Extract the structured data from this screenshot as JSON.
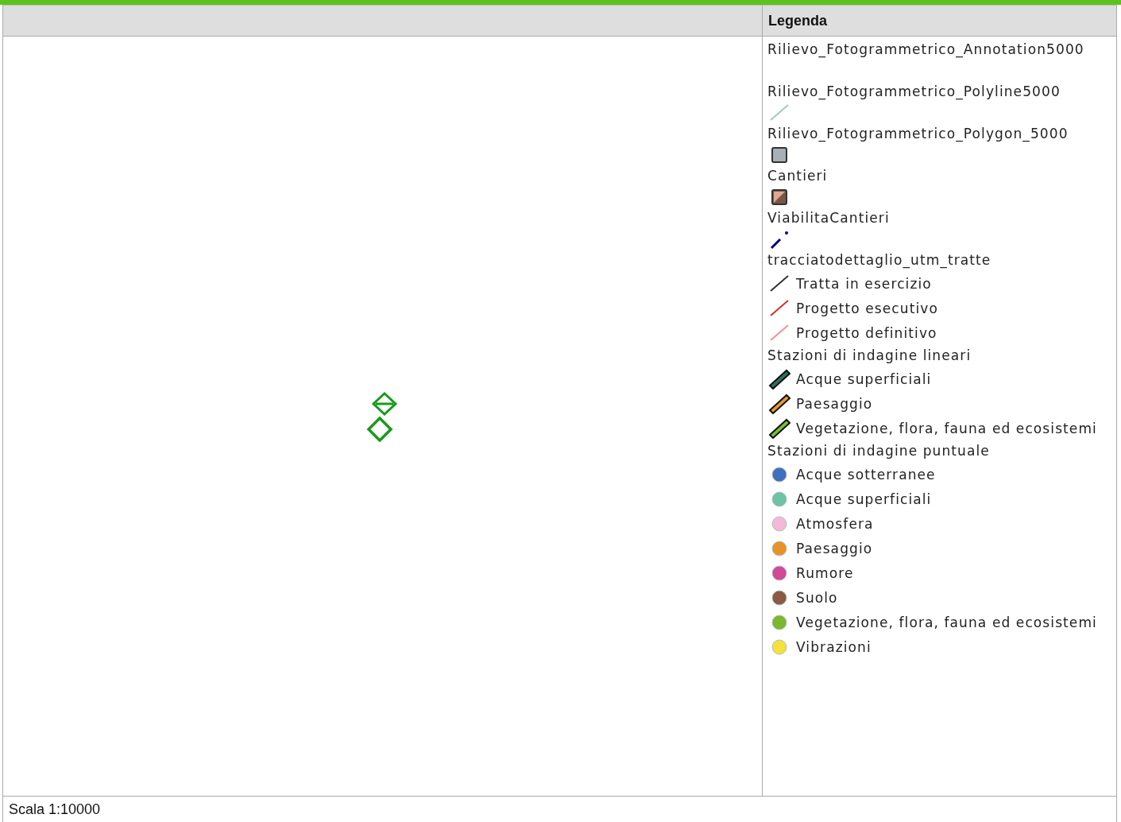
{
  "header": {
    "legend_title": "Legenda"
  },
  "legend": {
    "layers": [
      {
        "title": "Rilievo_Fotogrammetrico_Annotation5000",
        "symbol": {
          "kind": "blank"
        }
      },
      {
        "title": "Rilievo_Fotogrammetrico_Polyline5000",
        "symbol": {
          "kind": "line",
          "color": "#a9c4c0"
        }
      },
      {
        "title": "Rilievo_Fotogrammetrico_Polygon_5000",
        "symbol": {
          "kind": "square",
          "color": "#a7b0b6"
        }
      },
      {
        "title": "Cantieri",
        "symbol": {
          "kind": "split-square",
          "color": "#7a5548"
        }
      },
      {
        "title": "ViabilitaCantieri",
        "symbol": {
          "kind": "dashed",
          "color": "#00008b"
        }
      },
      {
        "title": "tracciatodettaglio_utm_tratte",
        "items": [
          {
            "label": "Tratta in esercizio",
            "kind": "line",
            "color": "#333333"
          },
          {
            "label": "Progetto esecutivo",
            "kind": "line",
            "color": "#d03030"
          },
          {
            "label": "Progetto definitivo",
            "kind": "line",
            "color": "#f4909a"
          }
        ]
      },
      {
        "title": "Stazioni di indagine lineari",
        "items": [
          {
            "label": "Acque superficiali",
            "kind": "bar",
            "color": "#2f6f5f"
          },
          {
            "label": "Paesaggio",
            "kind": "bar",
            "color": "#e89a2a"
          },
          {
            "label": "Vegetazione, flora, fauna ed ecosistemi",
            "kind": "bar",
            "color": "#7ac232"
          }
        ]
      },
      {
        "title": "Stazioni di indagine puntuale",
        "items": [
          {
            "label": "Acque sotterranee",
            "kind": "dot",
            "color": "#3f6fbf"
          },
          {
            "label": "Acque superficiali",
            "kind": "dot",
            "color": "#6cc3a8"
          },
          {
            "label": "Atmosfera",
            "kind": "dot",
            "color": "#f4b8d8"
          },
          {
            "label": "Paesaggio",
            "kind": "dot",
            "color": "#e8922a"
          },
          {
            "label": "Rumore",
            "kind": "dot",
            "color": "#d04a9a"
          },
          {
            "label": "Suolo",
            "kind": "dot",
            "color": "#8a5a44"
          },
          {
            "label": "Vegetazione, flora, fauna ed ecosistemi",
            "kind": "dot",
            "color": "#7ab830"
          },
          {
            "label": "Vibrazioni",
            "kind": "dot",
            "color": "#f2e23a"
          }
        ]
      }
    ]
  },
  "footer": {
    "scale": "Scala 1:10000"
  }
}
